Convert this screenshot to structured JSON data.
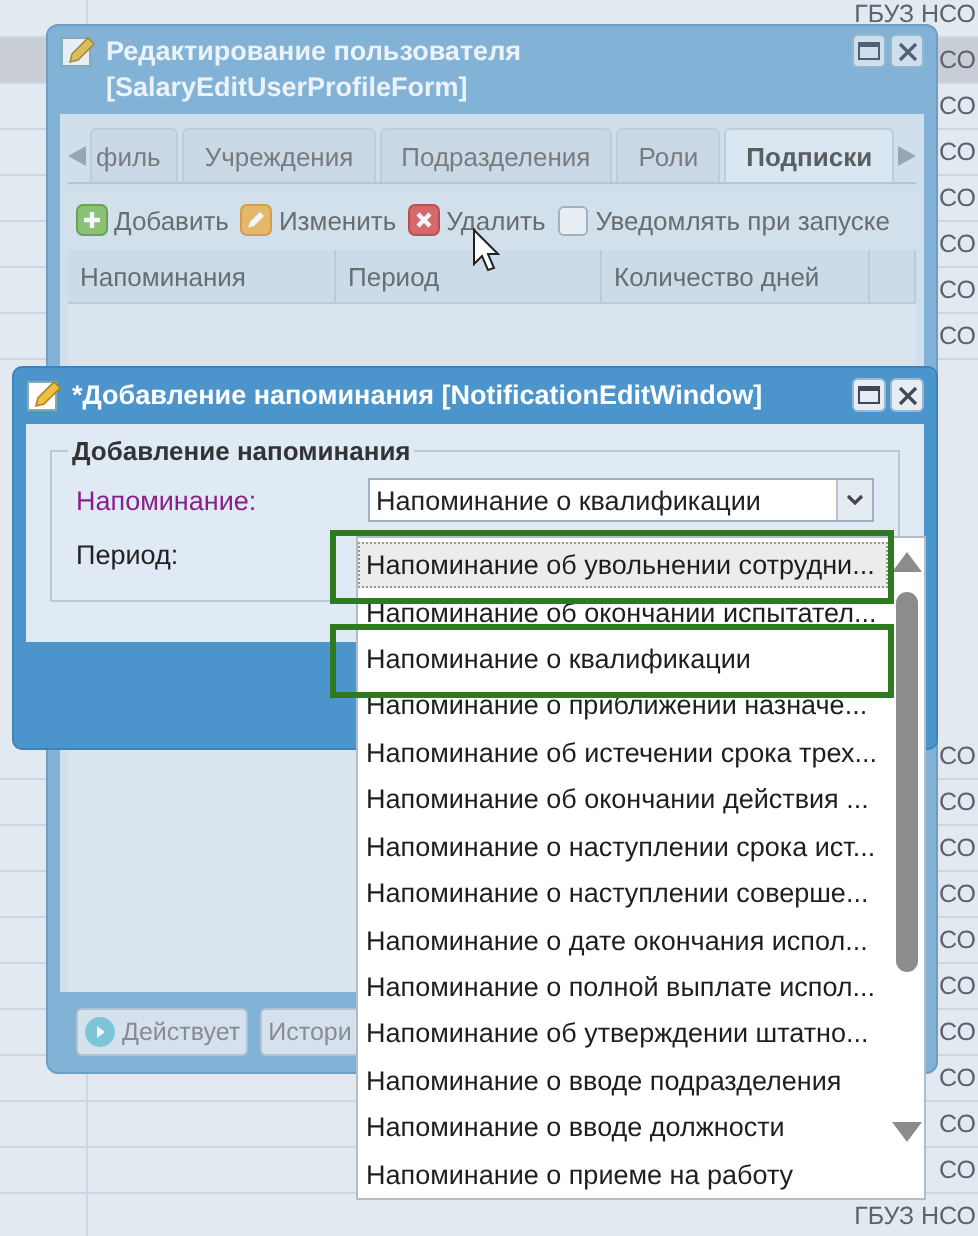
{
  "background_grid": {
    "top_rows": [
      {
        "text": "ГБУЗ НСО",
        "selected": false
      },
      {
        "text": "СО",
        "selected": true
      },
      {
        "text": "СО",
        "selected": false
      },
      {
        "text": "СО",
        "selected": false
      },
      {
        "text": "СО",
        "selected": false
      },
      {
        "text": "СО",
        "selected": false
      },
      {
        "text": "СО",
        "selected": false
      },
      {
        "text": "СО",
        "selected": false
      }
    ],
    "bottom_rows": [
      {
        "text": "СО",
        "selected": false
      },
      {
        "text": "СО",
        "selected": false
      },
      {
        "text": "СО",
        "selected": false
      },
      {
        "text": "СО",
        "selected": false
      },
      {
        "text": "СО",
        "selected": false
      },
      {
        "text": "СО",
        "selected": false
      },
      {
        "text": "СО",
        "selected": false
      },
      {
        "text": "СО",
        "selected": false
      },
      {
        "text": "СО",
        "selected": false
      },
      {
        "text": "СО",
        "selected": false
      },
      {
        "text": "ГБУЗ НСО",
        "selected": false
      }
    ]
  },
  "back_window": {
    "title": "Редактирование пользователя [SalaryEditUserProfileForm]",
    "tabs": [
      {
        "label": "филь",
        "selected": false
      },
      {
        "label": "Учреждения",
        "selected": false
      },
      {
        "label": "Подразделения",
        "selected": false
      },
      {
        "label": "Роли",
        "selected": false
      },
      {
        "label": "Подписки",
        "selected": true
      }
    ],
    "toolbar": [
      {
        "kind": "add",
        "label": "Добавить"
      },
      {
        "kind": "edit",
        "label": "Изменить"
      },
      {
        "kind": "delete",
        "label": "Удалить"
      }
    ],
    "notify_checkbox": {
      "label": "Уведомлять при запуске",
      "checked": false
    },
    "columns": [
      "Напоминания",
      "Период",
      "Количество дней"
    ],
    "footer_buttons": [
      {
        "kind": "status",
        "label": "Действует"
      },
      {
        "kind": "plain",
        "label": "Истори"
      }
    ]
  },
  "dialog": {
    "title": "*Добавление напоминания [NotificationEditWindow]",
    "section_title": "Добавление напоминания",
    "fields": [
      {
        "label": "Напоминание:",
        "highlighted": true,
        "value": "Напоминание о квалификации"
      },
      {
        "label": "Период:",
        "highlighted": false
      }
    ]
  },
  "dropdown": {
    "items": [
      {
        "text": "Напоминание об увольнении сотрудни...",
        "selected": true,
        "marked": true
      },
      {
        "text": "Напоминание об окончании испытател...",
        "selected": false,
        "marked": false
      },
      {
        "text": "Напоминание о квалификации",
        "selected": false,
        "marked": true
      },
      {
        "text": "Напоминание о приближении назначе...",
        "selected": false,
        "marked": false
      },
      {
        "text": "Напоминание об истечении срока трех...",
        "selected": false,
        "marked": false
      },
      {
        "text": "Напоминание об окончании действия ...",
        "selected": false,
        "marked": false
      },
      {
        "text": "Напоминание о наступлении срока ист...",
        "selected": false,
        "marked": false
      },
      {
        "text": "Напоминание о наступлении соверше...",
        "selected": false,
        "marked": false
      },
      {
        "text": "Напоминание о дате окончания испол...",
        "selected": false,
        "marked": false
      },
      {
        "text": "Напоминание о полной выплате испол...",
        "selected": false,
        "marked": false
      },
      {
        "text": "Напоминание об утверждении штатно...",
        "selected": false,
        "marked": false
      },
      {
        "text": "Напоминание о вводе подразделения",
        "selected": false,
        "marked": false
      },
      {
        "text": "Напоминание о вводе должности",
        "selected": false,
        "marked": false
      },
      {
        "text": "Напоминание о приеме на работу",
        "selected": false,
        "marked": false
      }
    ]
  }
}
